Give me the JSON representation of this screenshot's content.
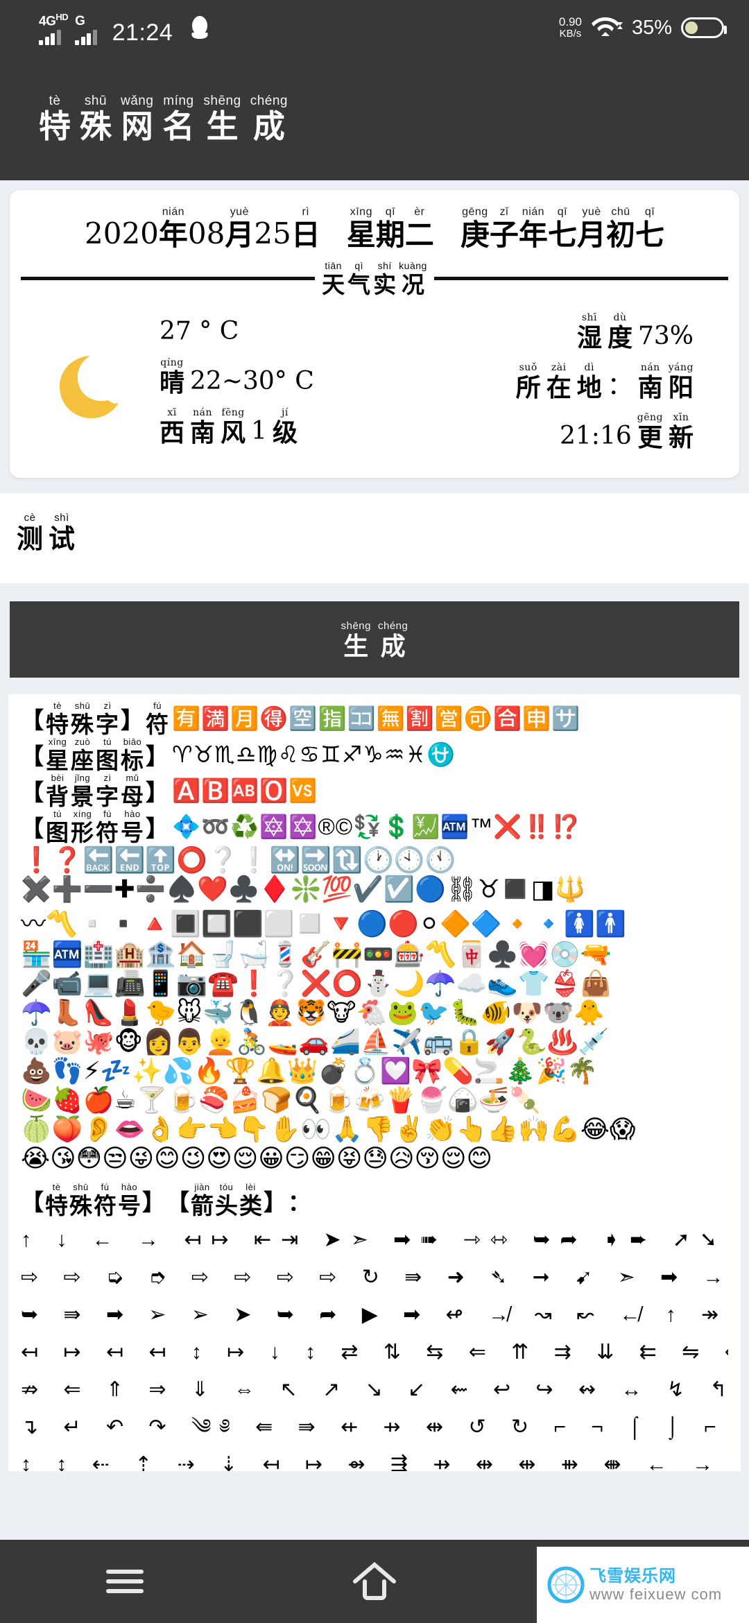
{
  "statusbar": {
    "network_type": "4G",
    "network_type_sup": "HD",
    "network_type2": "G",
    "time": "21:24",
    "qq_icon": "penguin-icon",
    "net_speed_value": "0.90",
    "net_speed_unit": "KB/s",
    "wifi_icon": "wifi-icon",
    "battery_percent": "35%",
    "battery_level": 35
  },
  "appbar": {
    "title_chars": [
      {
        "hz": "特",
        "py": "tè"
      },
      {
        "hz": "殊",
        "py": "shū"
      },
      {
        "hz": "网",
        "py": "wǎng"
      },
      {
        "hz": "名",
        "py": "míng"
      },
      {
        "hz": "生",
        "py": "shēng"
      },
      {
        "hz": "成",
        "py": "chéng"
      }
    ]
  },
  "card": {
    "date_parts": [
      {
        "type": "num",
        "text": "2020"
      },
      {
        "type": "ruby",
        "hz": "年",
        "py": "nián"
      },
      {
        "type": "num",
        "text": "08"
      },
      {
        "type": "ruby",
        "hz": "月",
        "py": "yuè"
      },
      {
        "type": "num",
        "text": "25"
      },
      {
        "type": "ruby",
        "hz": "日",
        "py": "rì"
      },
      {
        "type": "gap-md"
      },
      {
        "type": "ruby",
        "hz": "星",
        "py": "xīng"
      },
      {
        "type": "ruby",
        "hz": "期",
        "py": "qī"
      },
      {
        "type": "ruby",
        "hz": "二",
        "py": "èr"
      },
      {
        "type": "gap-md"
      },
      {
        "type": "ruby",
        "hz": "庚",
        "py": "gēng"
      },
      {
        "type": "ruby",
        "hz": "子",
        "py": "zǐ"
      },
      {
        "type": "ruby",
        "hz": "年",
        "py": "nián"
      },
      {
        "type": "ruby",
        "hz": "七",
        "py": "qī"
      },
      {
        "type": "ruby",
        "hz": "月",
        "py": "yuè"
      },
      {
        "type": "ruby",
        "hz": "初",
        "py": "chū"
      },
      {
        "type": "ruby",
        "hz": "七",
        "py": "qī"
      }
    ],
    "divider_label": [
      {
        "hz": "天",
        "py": "tiān"
      },
      {
        "hz": "气",
        "py": "qì"
      },
      {
        "hz": "实",
        "py": "shí"
      },
      {
        "hz": "况",
        "py": "kuàng"
      }
    ],
    "weather": {
      "icon": "moon-icon",
      "temperature": "27 ° C",
      "condition_parts": [
        {
          "type": "ruby",
          "hz": "晴",
          "py": "qíng"
        },
        {
          "type": "plain",
          "text": "22~30° C"
        }
      ],
      "wind_parts": [
        {
          "type": "ruby",
          "hz": "西",
          "py": "xī"
        },
        {
          "type": "ruby",
          "hz": "南",
          "py": "nán"
        },
        {
          "type": "ruby",
          "hz": "风",
          "py": "fēng"
        },
        {
          "type": "plain",
          "text": "1"
        },
        {
          "type": "ruby",
          "hz": "级",
          "py": "jí"
        }
      ],
      "humidity_parts": [
        {
          "type": "ruby",
          "hz": "湿",
          "py": "shī"
        },
        {
          "type": "ruby",
          "hz": "度",
          "py": "dù"
        },
        {
          "type": "plain",
          "text": "73%"
        }
      ],
      "location_parts": [
        {
          "type": "ruby",
          "hz": "所",
          "py": "suǒ"
        },
        {
          "type": "ruby",
          "hz": "在",
          "py": "zài"
        },
        {
          "type": "ruby",
          "hz": "地",
          "py": "dì"
        },
        {
          "type": "plain",
          "text": "："
        },
        {
          "type": "ruby",
          "hz": "南",
          "py": "nán"
        },
        {
          "type": "ruby",
          "hz": "阳",
          "py": "yáng"
        }
      ],
      "update_parts": [
        {
          "type": "plain",
          "text": "21:16"
        },
        {
          "type": "ruby",
          "hz": "更",
          "py": "gēng"
        },
        {
          "type": "ruby",
          "hz": "新",
          "py": "xīn"
        }
      ]
    }
  },
  "input": {
    "value_parts": [
      {
        "hz": "测",
        "py": "cè"
      },
      {
        "hz": "试",
        "py": "shì"
      }
    ],
    "placeholder": ""
  },
  "generate_button": {
    "label_parts": [
      {
        "hz": "生",
        "py": "shēng"
      },
      {
        "hz": "成",
        "py": "chéng"
      }
    ]
  },
  "symbol_panel": {
    "categories": [
      {
        "label_parts": [
          {
            "hz": "特",
            "py": "tè"
          },
          {
            "hz": "殊",
            "py": "shū"
          },
          {
            "hz": "字",
            "py": "zì"
          }
        ],
        "suffix": "符",
        "suffix_py": "fú",
        "glyphs": "🈶🈵🈷️🉐🈳🈯️🈁🈚️🈹🈺🉑🈴🈸🈂️"
      },
      {
        "label_parts": [
          {
            "hz": "星",
            "py": "xīng"
          },
          {
            "hz": "座",
            "py": "zuò"
          },
          {
            "hz": "图",
            "py": "tú"
          },
          {
            "hz": "标",
            "py": "biāo"
          }
        ],
        "suffix": "",
        "suffix_py": "",
        "glyphs": "♈♉♏♎♍♌♋♊♐♑♒♓⛎"
      },
      {
        "label_parts": [
          {
            "hz": "背",
            "py": "bèi"
          },
          {
            "hz": "景",
            "py": "jǐng"
          },
          {
            "hz": "字",
            "py": "zì"
          },
          {
            "hz": "母",
            "py": "mǔ"
          }
        ],
        "suffix": "",
        "suffix_py": "",
        "glyphs": "🅰️🅱️🆎🅾️🆚"
      },
      {
        "label_parts": [
          {
            "hz": "图",
            "py": "tú"
          },
          {
            "hz": "形",
            "py": "xíng"
          },
          {
            "hz": "符",
            "py": "fú"
          },
          {
            "hz": "号",
            "py": "hào"
          }
        ],
        "suffix": "",
        "suffix_py": "",
        "glyphs": "💠➿♻️🔯✡️®©💱💲💹🏧™❌‼️⁉️"
      }
    ],
    "glyph_rows": [
      "❗❓🔙🔚🔝⭕❔❕🔛🔜🔃🕐🕙🕚",
      "✖️➕➖✚➗♠️❤️♣️♦️❇️💯✔️☑️🔵⛓♉◼️◨🔱",
      "〰〽️▫️▪️🔺🔳🔲⬛⬜◻️🔻🔵🔴⚪🔶🔷🔸🔹🚺🚹",
      "🏪🏧🏥🏨🏦🏠🚽🛁💈🎸🚧🚥🎰〽️🀄♣️💓💿🔫",
      "🎤📹💻📠📱📷☎️❗❔❌⭕⛄🌙☂️☁️👟👕👙👜",
      "☂️👢👠💄🐤🐭🐳🐧👲🐯🐮🐔🐸🐦🐛🐠🐶🐨🐥",
      "💀🐷🐙🐵👩👨👱🚴🚤🚗🚄⛵✈️🚌🔒🚀🐍♨️💉",
      "💩👣⚡💤✨💦🔥🏆🔔👑💣💍💟🎀💊🚬🎄🎉🌴",
      "🍉🍓🍎☕🍸🍺🍣🍰🍞🍳🍺🍻🍟🍧🍙🍜🍡",
      "🍈🍑👂👄👌👉👈👇✋👀🙏👎✌️👏👆👍🙌💪😂😱",
      "😭😘😳😒😜😊😉😍😌😀😏😁😝😓😥😚😌😊"
    ],
    "special_section": {
      "label_parts": [
        {
          "hz": "特",
          "py": "tè"
        },
        {
          "hz": "殊",
          "py": "shū"
        },
        {
          "hz": "符",
          "py": "fú"
        },
        {
          "hz": "号",
          "py": "hào"
        }
      ],
      "label2_parts": [
        {
          "hz": "箭",
          "py": "jiàn"
        },
        {
          "hz": "头",
          "py": "tóu"
        },
        {
          "hz": "类",
          "py": "lèi"
        }
      ],
      "colon": "："
    },
    "arrow_rows": [
      "↑ ↓ ← →        ↤↦ ⇤⇥ ➤➣ ➡➠ ⇾⇿ ➥➦ ➧➨ ➚➘ ➙➶",
      "⇨ ⇨ ➭ ➮ ⇨ ⇨ ⇨ ⇨ ↻ ⇛ ➜ ➴ ➞ ➹ ➣ ➡ → →",
      "➥ ⇛ ➡ ➢ ➢ ➤ ➥ ➦ ▶ ➡ ↫ ↛ ↝ ↜ ↚ ↑ ↠ ↠ ↓",
      "↤ ↦ ↤ ↤ ↕ ↦ ↓ ↕ ⇄ ⇅ ⇆ ⇐ ⇈ ⇉ ⇊ ⇇ ⇋ ⇍ ⇎",
      "⇏ ⇐ ⇑ ⇒ ⇓ ⇔ ↖ ↗ ↘ ↙ ⇜  ↩ ↪ ↭ ↔ ↯ ↰ ↱ ↲ ↳",
      "↴ ↵ ↶ ↷ ༄༅ ⇚ ⇛ ⇷ ⇸ ⇹ ↺ ↻ ⌐ ¬ ⌠ ⌡ ⌐ ¬ ↓ ↓",
      "↨ ↨ ⇠ ⇡ ⇢ ⇣ ↤ ↦ ⇴ ⇶ ⇸ ⇹ ⇹ ⇻ ⇼ ← → ↔ ↞ Ⅲ ⇦"
    ]
  },
  "navbar": {
    "items": [
      {
        "icon": "menu-icon",
        "name": "recents-button"
      },
      {
        "icon": "home-icon",
        "name": "home-button"
      },
      {
        "icon": "back-icon",
        "name": "back-button"
      }
    ]
  },
  "watermark": {
    "logo": "compass-icon",
    "site_name": "飞雪娱乐网",
    "url": "www feixuew com"
  },
  "colors": {
    "bar": "#383838",
    "page_bg": "#eceff3",
    "card_bg": "#ffffff",
    "accent_moon": "#f5c13c",
    "battery_fill": "#dfe0b4",
    "watermark_blue": "#33b5f0"
  }
}
